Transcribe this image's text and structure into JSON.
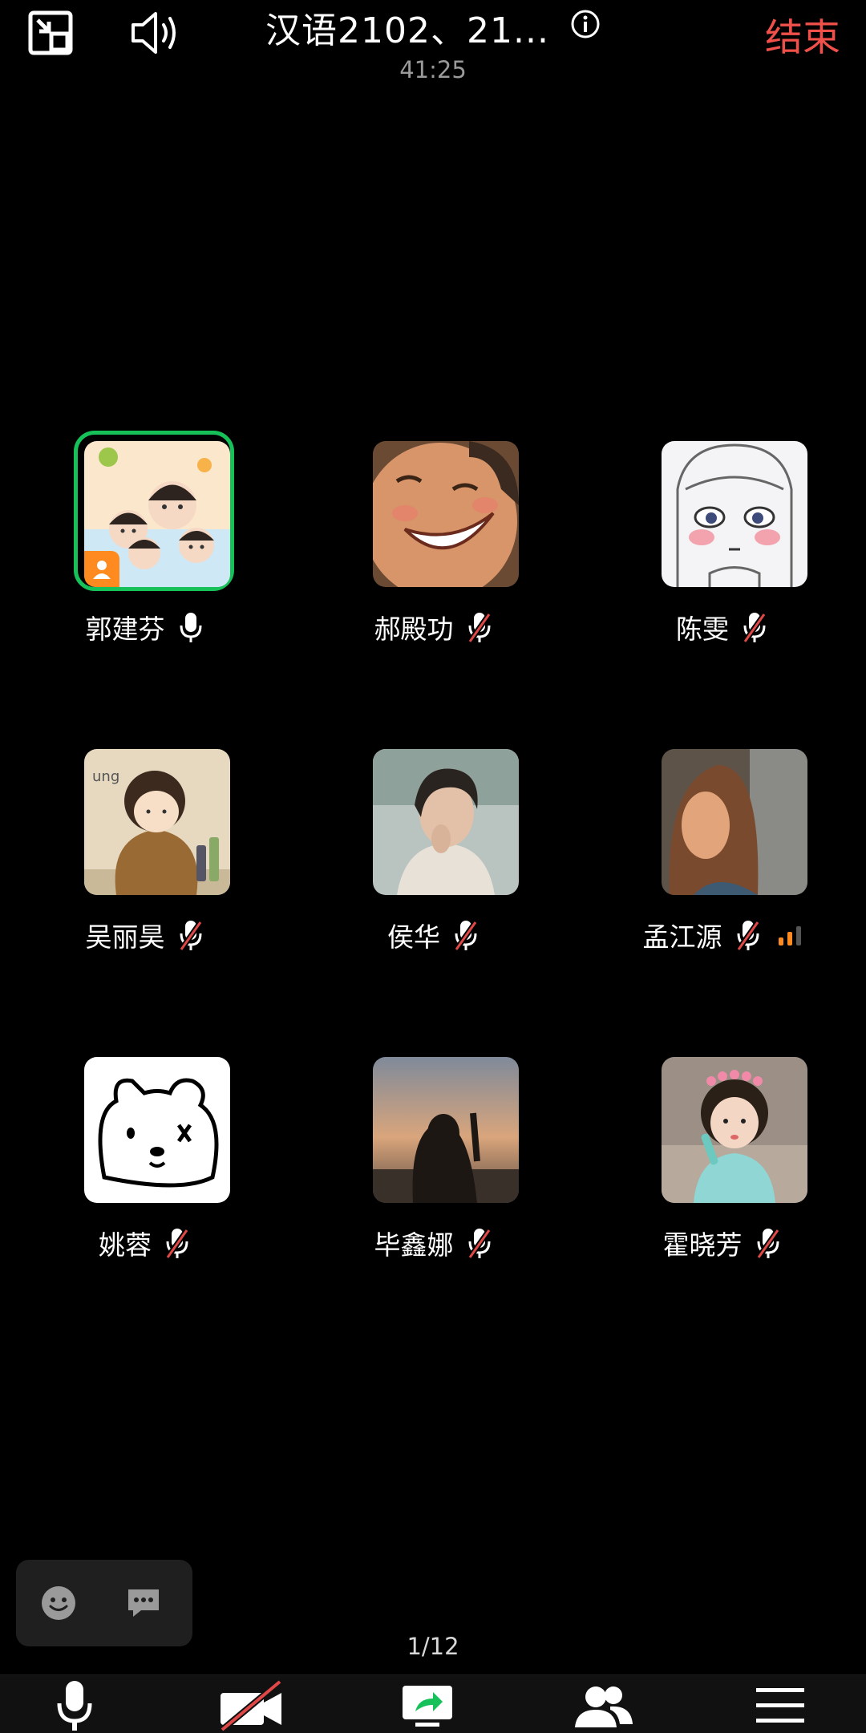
{
  "header": {
    "title": "汉语2102、21...",
    "elapsed_time": "41:25",
    "end_label": "结束",
    "icons": [
      "minimize-window-icon",
      "speaker-icon",
      "info-icon"
    ],
    "colors": {
      "end": "#f0504a"
    }
  },
  "participants": [
    {
      "name": "郭建芬",
      "muted": false,
      "speaking": true,
      "host": true,
      "avatar": "cartoon-family-avatar"
    },
    {
      "name": "郝殿功",
      "muted": true,
      "avatar": "laughing-cartoon-avatar"
    },
    {
      "name": "陈雯",
      "muted": true,
      "avatar": "sketch-girl-avatar"
    },
    {
      "name": "吴丽昊",
      "muted": true,
      "avatar": "illustrated-woman-avatar"
    },
    {
      "name": "侯华",
      "muted": true,
      "avatar": "photo-man-avatar"
    },
    {
      "name": "孟江源",
      "muted": true,
      "avatar": "photo-woman-avatar",
      "signal_level": 2
    },
    {
      "name": "姚蓉",
      "muted": true,
      "avatar": "bear-drawing-avatar"
    },
    {
      "name": "毕鑫娜",
      "muted": true,
      "avatar": "sunset-silhouette-avatar"
    },
    {
      "name": "霍晓芳",
      "muted": true,
      "avatar": "little-girl-avatar"
    }
  ],
  "pager": {
    "text": "1/12"
  },
  "chat_panel": {
    "icons": [
      "emoji-icon",
      "chat-bubble-icon"
    ]
  },
  "toolbar": {
    "items": [
      "microphone-icon",
      "camera-off-icon",
      "share-screen-icon",
      "participants-icon",
      "menu-icon"
    ]
  },
  "colors": {
    "active_ring": "#17c15a",
    "host_badge": "#ff8a1f",
    "signal": "#ff8a1f",
    "muted_slash": "#e04848"
  }
}
